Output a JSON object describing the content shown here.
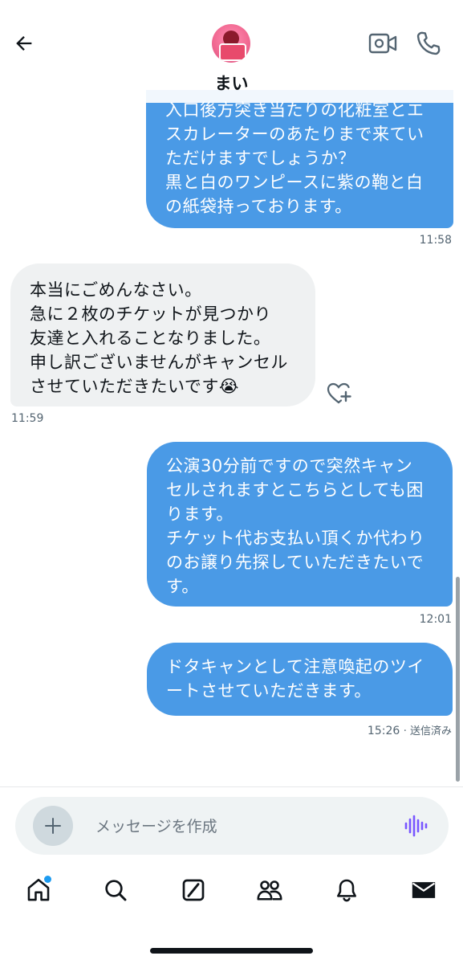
{
  "header": {
    "contact_name": "まい"
  },
  "messages": [
    {
      "direction": "sent",
      "text": "入口後方突き当たりの化粧室とエ\nスカレーターのあたりまで来てい\nただけますでしょうか？\n黒と白のワンピースに紫の鞄と白\nの紙袋持っております。",
      "time": "11:58"
    },
    {
      "direction": "received",
      "text": "本当にごめんなさい。\n急に２枚のチケットが見つかり\n友達と入れることなりました。\n申し訳ございませんがキャンセル\nさせていただきたいです😭",
      "time": "11:59"
    },
    {
      "direction": "sent",
      "text": "公演30分前ですので突然キャン\nセルされますとこちらとしても困\nります。\nチケット代お支払い頂くか代わり\nのお譲り先探していただきたいで\nす。",
      "time": "12:01"
    },
    {
      "direction": "sent",
      "text": "ドタキャンとして注意喚起のツイ\nートさせていただきます。",
      "time": "15:26",
      "status": "· 送信済み"
    }
  ],
  "composer": {
    "placeholder": "メッセージを作成"
  },
  "icons": {
    "back": "arrow-left-icon",
    "video": "video-camera-icon",
    "phone": "phone-icon",
    "heart_add": "heart-plus-icon",
    "add": "plus-icon",
    "voice": "voice-wave-icon",
    "tabs": [
      "home-icon",
      "search-icon",
      "grok-icon",
      "communities-icon",
      "bell-icon",
      "mail-icon"
    ]
  },
  "colors": {
    "sent_bubble": "#4a9ae6",
    "received_bubble": "#eff1f2",
    "voice_accent": "#7856ff",
    "notification_dot": "#1d9bf0"
  }
}
